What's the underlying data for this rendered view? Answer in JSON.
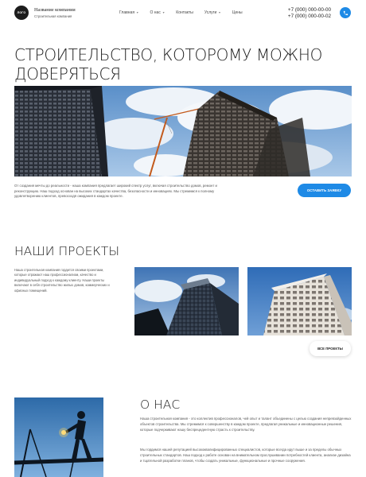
{
  "header": {
    "logo_text": "ЛОГО",
    "company_name": "Название компании",
    "company_sub": "Строительная компания",
    "nav": [
      {
        "label": "Главная",
        "has_dropdown": true
      },
      {
        "label": "О нас",
        "has_dropdown": true
      },
      {
        "label": "Контакты",
        "has_dropdown": false
      },
      {
        "label": "Услуги",
        "has_dropdown": true
      },
      {
        "label": "Цены",
        "has_dropdown": false
      }
    ],
    "phone_1": "+7 (000) 000-00-00",
    "phone_2": "+7 (000) 000-00-02",
    "call_icon": "phone-icon"
  },
  "hero": {
    "title": "Строительство, которому можно доверяться",
    "text": "От создания мечты до реальности - наша компания предлагает широкий спектр услуг, включая строительство домов, ремонт и реконструкцию. Наш подход основан на высоких стандартах качества, безопасности и инновациях. Мы стремимся к полному удовлетворению клиентов, превосходя ожидания в каждом проекте.",
    "cta_label": "Оставить заявку"
  },
  "projects": {
    "title": "Наши проекты",
    "text": "Наша строительная компания гордится своими проектами, которые отражают наш профессионализм, качество и индивидуальный подход к каждому клиенту. Наши проекты включают в себя строительство жилых домов, коммерческих и офисных помещений.",
    "all_label": "Все проекты"
  },
  "about": {
    "title": "О нас",
    "p1": "Наша строительная компания - это коллектив профессионалов, чей опыт и талант объединены с целью создания непревзойденных объектов строительства. Мы стремимся к совершенству в каждом проекте, предлагая уникальные и инновационные решения, которые подчеркивают нашу беспрецедентную страсть к строительству.",
    "p2": "Мы гордимся нашей репутацией высококвалифицированных специалистов, которые всегда идут выше и за пределы обычных строительных стандартов. Наш подход к работе основан на внимательном прослушивании потребностей клиента, анализе дизайна и тщательной разработке планов, чтобы создать уникальные, функциональные и прочные сооружения."
  },
  "colors": {
    "accent": "#1e8ae6",
    "text_dark": "#222222",
    "text_muted": "#555555"
  }
}
